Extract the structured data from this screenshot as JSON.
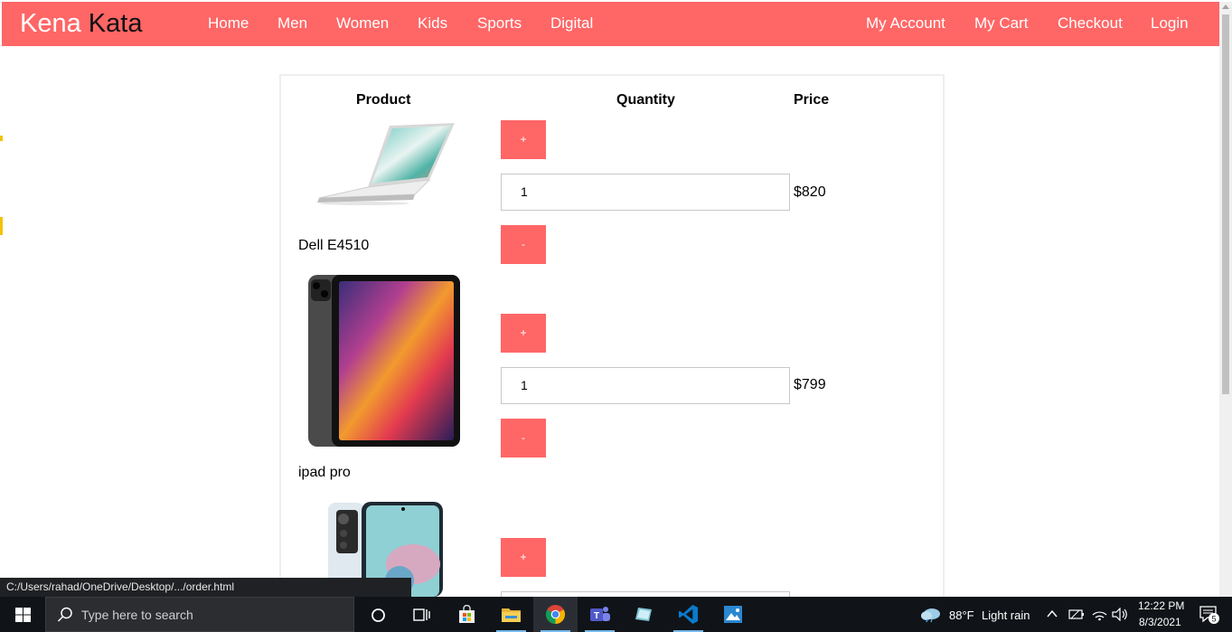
{
  "brand": {
    "part1": "Kena",
    "part2": "Kata"
  },
  "nav": {
    "left": [
      "Home",
      "Men",
      "Women",
      "Kids",
      "Sports",
      "Digital"
    ],
    "right": [
      "My Account",
      "My Cart",
      "Checkout",
      "Login"
    ]
  },
  "table": {
    "headers": {
      "product": "Product",
      "quantity": "Quantity",
      "price": "Price"
    },
    "rows": [
      {
        "name": "Dell E4510",
        "qty": "1",
        "price": "$820",
        "plus": "+",
        "minus": "-"
      },
      {
        "name": "ipad pro",
        "qty": "1",
        "price": "$799",
        "plus": "+",
        "minus": "-"
      },
      {
        "name": "",
        "qty": "",
        "price": "",
        "plus": "+",
        "minus": "-"
      }
    ]
  },
  "status_url": "C:/Users/rahad/OneDrive/Desktop/.../order.html",
  "taskbar": {
    "search_placeholder": "Type here to search",
    "weather_temp": "88°F",
    "weather_text": "Light rain",
    "time": "12:22 PM",
    "date": "8/3/2021",
    "notification_count": "5"
  },
  "colors": {
    "accent": "#ff6666",
    "taskbar": "#101418"
  }
}
